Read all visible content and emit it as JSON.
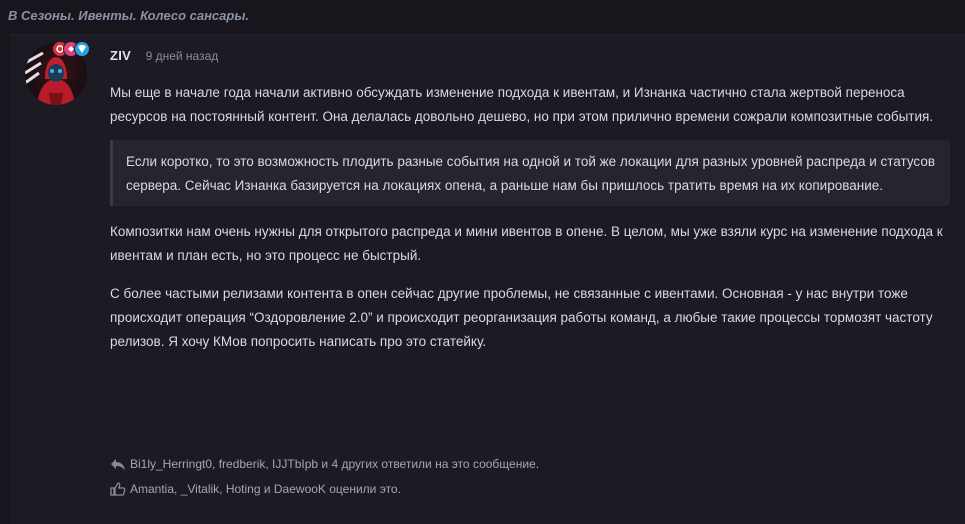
{
  "breadcrumb": {
    "prefix": "В",
    "items": [
      "Сезоны.",
      "Ивенты.",
      "Колесо сансары."
    ]
  },
  "post": {
    "author": "ZIV",
    "timestamp": "9 дней назад",
    "paragraphs": [
      "Мы еще в начале года начали активно обсуждать изменение подхода к ивентам, и Изнанка частично стала жертвой переноса ресурсов на постоянный контент. Она делалась довольно дешево, но при этом прилично времени сожрали композитные события."
    ],
    "quote": "Если коротко, то это возможность плодить разные события на одной и той же локации для разных уровней распреда и статусов сервера. Сейчас Изнанка базируется на локациях опена, а раньше нам бы пришлось тратить время на их копирование.",
    "paragraphs_after": [
      "Композитки нам очень нужны для открытого распреда и мини ивентов в опене. В целом, мы уже взяли курс на изменение подхода к ивентам и план есть, но это процесс не быстрый.",
      "С более частыми релизами контента в опен сейчас другие проблемы, не связанные с ивентами. Основная - у нас внутри тоже происходит операция “Оздоровление 2.0” и происходит реорганизация работы команд, а любые такие процессы тормозят частоту релизов. Я хочу КМов попросить написать про это статейку."
    ],
    "replies_text": "Bi1ly_Herringt0, fredberik, IJJTbIpb и 4 других ответили на это сообщение.",
    "likes_text": "Amantia, _Vitalik, Hoting и DaewooK оценили это."
  },
  "icons": {
    "reply": "reply-arrow-icon",
    "like": "thumbs-up-icon"
  },
  "colors": {
    "background": "#16161c",
    "post_background": "#1c1b24",
    "quote_background": "#26252f",
    "breadcrumb": "#8a93a3"
  }
}
